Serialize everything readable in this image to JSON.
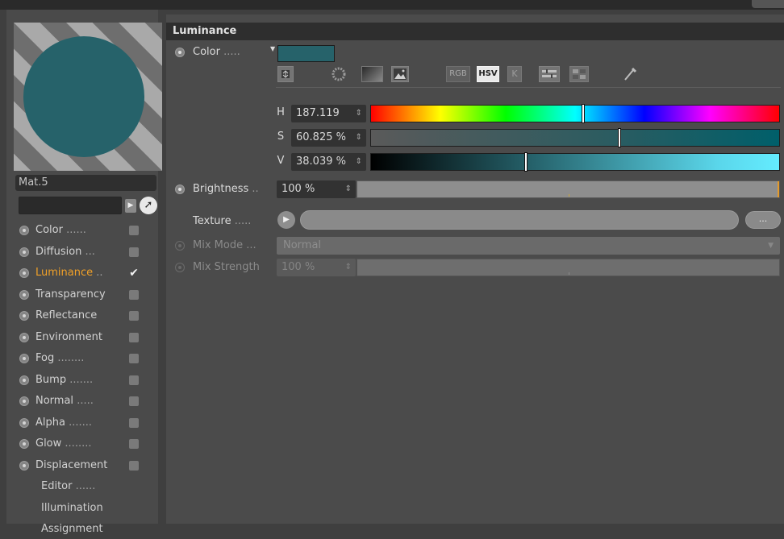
{
  "material": {
    "name": "Mat.5",
    "preview_color": "#26626a",
    "search_value": ""
  },
  "channels": [
    {
      "label": "Color",
      "dots": "......",
      "enabled": false,
      "active": false
    },
    {
      "label": "Diffusion",
      "dots": "...",
      "enabled": false,
      "active": false
    },
    {
      "label": "Luminance",
      "dots": "..",
      "enabled": true,
      "active": true
    },
    {
      "label": "Transparency",
      "dots": "",
      "enabled": false,
      "active": false
    },
    {
      "label": "Reflectance",
      "dots": "",
      "enabled": false,
      "active": false
    },
    {
      "label": "Environment",
      "dots": "",
      "enabled": false,
      "active": false
    },
    {
      "label": "Fog",
      "dots": "........",
      "enabled": false,
      "active": false
    },
    {
      "label": "Bump",
      "dots": ".......",
      "enabled": false,
      "active": false
    },
    {
      "label": "Normal",
      "dots": ".....",
      "enabled": false,
      "active": false
    },
    {
      "label": "Alpha",
      "dots": ".......",
      "enabled": false,
      "active": false
    },
    {
      "label": "Glow",
      "dots": "........",
      "enabled": false,
      "active": false
    },
    {
      "label": "Displacement",
      "dots": "",
      "enabled": false,
      "active": false
    }
  ],
  "extra_items": [
    {
      "label": "Editor",
      "dots": "......"
    },
    {
      "label": "Illumination",
      "dots": ""
    },
    {
      "label": "Assignment",
      "dots": ""
    }
  ],
  "panel": {
    "title": "Luminance",
    "color_label": "Color",
    "color_dots": ".....",
    "color_swatch": "#26626a",
    "mode_buttons": {
      "rgb": "RGB",
      "hsv": "HSV",
      "k": "K"
    },
    "h": {
      "label": "H",
      "value": "187.119",
      "fraction": 0.52
    },
    "s": {
      "label": "S",
      "value": "60.825 %",
      "fraction": 0.608
    },
    "v": {
      "label": "V",
      "value": "38.039 %",
      "fraction": 0.38
    },
    "brightness": {
      "label": "Brightness",
      "dots": "..",
      "value": "100 %",
      "fraction": 1.0
    },
    "texture": {
      "label": "Texture",
      "dots": ".....",
      "more": "..."
    },
    "mix_mode": {
      "label": "Mix Mode",
      "dots": "...",
      "value": "Normal"
    },
    "mix_strength": {
      "label": "Mix Strength",
      "value": "100 %",
      "fraction": 1.0
    },
    "spin_glyph": "⇕"
  }
}
